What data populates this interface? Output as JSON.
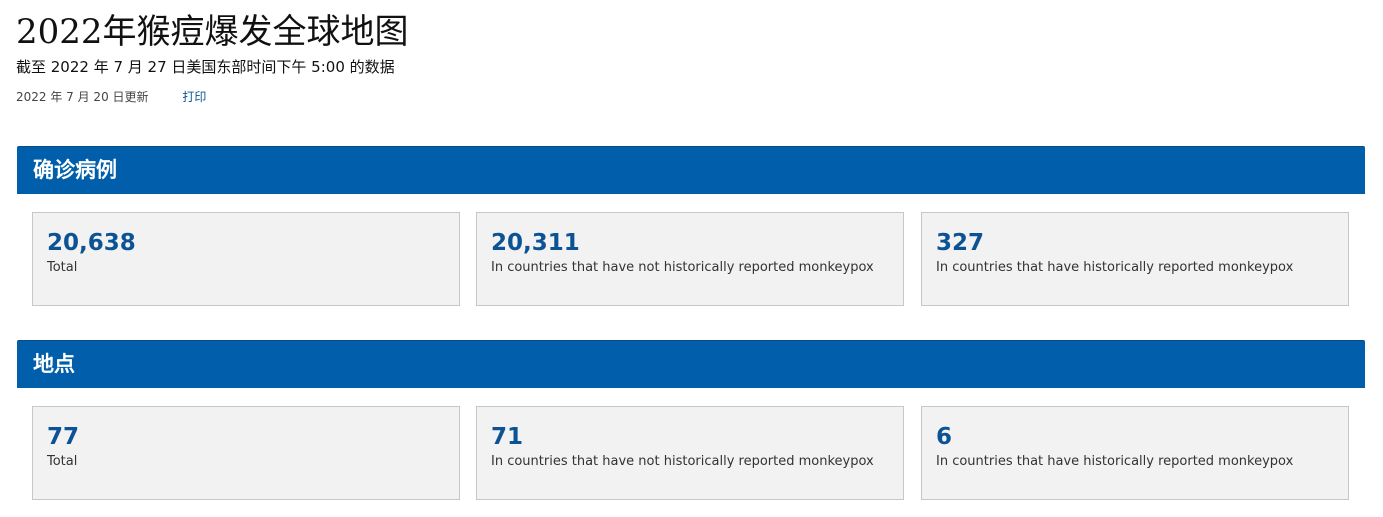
{
  "header": {
    "title": "2022年猴痘爆发全球地图",
    "subtitle": "截至 2022 年 7 月 27 日美国东部时间下午 5:00 的数据",
    "updated": "2022 年 7 月 20 日更新",
    "print_label": "打印"
  },
  "sections": {
    "cases": {
      "title": "确诊病例",
      "cards": [
        {
          "value": "20,638",
          "label": "Total"
        },
        {
          "value": "20,311",
          "label": "In countries that have not historically reported monkeypox"
        },
        {
          "value": "327",
          "label": "In countries that have historically reported monkeypox"
        }
      ]
    },
    "locations": {
      "title": "地点",
      "cards": [
        {
          "value": "77",
          "label": "Total"
        },
        {
          "value": "71",
          "label": "In countries that have not historically reported monkeypox"
        },
        {
          "value": "6",
          "label": "In countries that have historically reported monkeypox"
        }
      ]
    }
  },
  "colors": {
    "section_header_bg": "#005eaa",
    "value_text": "#0b5394",
    "card_bg": "#f2f2f2",
    "link": "#0b5394"
  }
}
